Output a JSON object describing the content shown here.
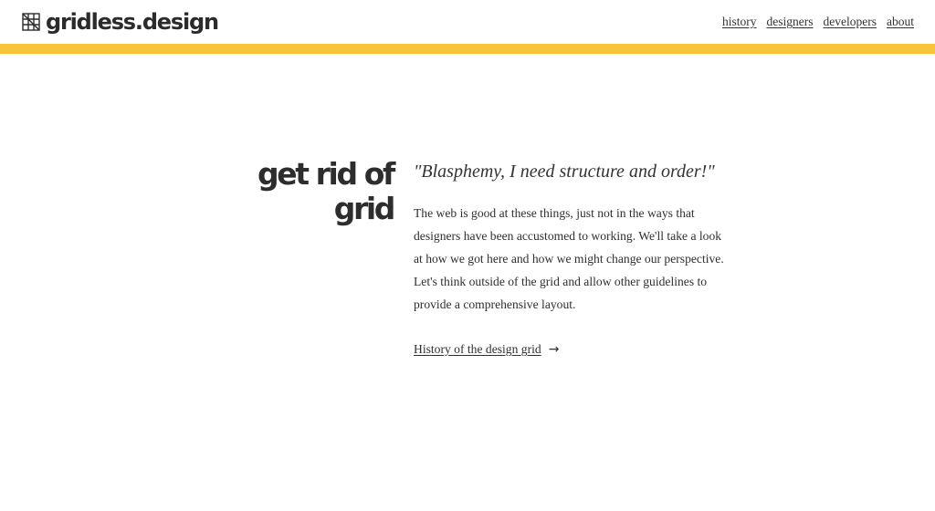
{
  "brand": {
    "name": "gridless.design",
    "icon": "grid-logo-icon"
  },
  "nav": [
    {
      "label": "history"
    },
    {
      "label": "designers"
    },
    {
      "label": "developers"
    },
    {
      "label": "about"
    }
  ],
  "colors": {
    "accent": "#f8c53a",
    "text": "#2d2d2d",
    "background": "#ffffff"
  },
  "hero": {
    "headline": "get rid of grid",
    "quote": "\"Blasphemy, I need structure and order!\"",
    "body": "The web is good at these things, just not in the ways that designers have been accustomed to working. We'll take a look at how we got here and how we might change our perspective. Let's think outside of the grid and allow other guidelines to provide a comprehensive layout.",
    "cta_label": "History of the design grid",
    "cta_arrow": "→"
  }
}
